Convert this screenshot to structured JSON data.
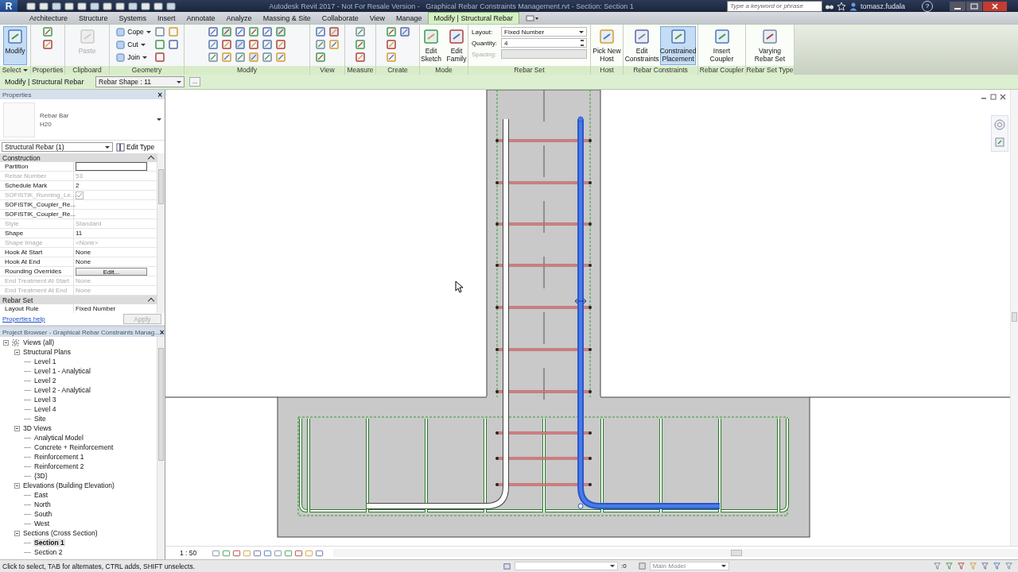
{
  "title_bar": {
    "app_button": "R",
    "title": "Autodesk Revit 2017 - Not For Resale Version -   Graphical Rebar Constraints Management.rvt - Section: Section 1",
    "search_placeholder": "Type a keyword or phrase",
    "user": "tomasz.fudala",
    "help": "?"
  },
  "tabs": [
    {
      "label": "Architecture",
      "selected": false
    },
    {
      "label": "Structure",
      "selected": false
    },
    {
      "label": "Systems",
      "selected": false
    },
    {
      "label": "Insert",
      "selected": false
    },
    {
      "label": "Annotate",
      "selected": false
    },
    {
      "label": "Analyze",
      "selected": false
    },
    {
      "label": "Massing & Site",
      "selected": false
    },
    {
      "label": "Collaborate",
      "selected": false
    },
    {
      "label": "View",
      "selected": false
    },
    {
      "label": "Manage",
      "selected": false
    },
    {
      "label": "Modify | Structural Rebar",
      "selected": true
    }
  ],
  "ribbon": {
    "panels": [
      {
        "label": "Select",
        "kind": "large",
        "dropdown": true,
        "tools": [
          {
            "lines": [
              "Modify"
            ],
            "selected": true,
            "disabled": false
          }
        ]
      },
      {
        "label": "Properties",
        "kind": "icons"
      },
      {
        "label": "Clipboard",
        "kind": "large",
        "tools": [
          {
            "lines": [
              "Paste"
            ],
            "selected": false,
            "disabled": true
          }
        ]
      },
      {
        "label": "Geometry",
        "kind": "small",
        "tools": [
          {
            "label": "Cope"
          },
          {
            "label": "Cut"
          },
          {
            "label": "Join"
          }
        ]
      },
      {
        "label": "Modify",
        "kind": "icons"
      },
      {
        "label": "View",
        "kind": "icons"
      },
      {
        "label": "Measure",
        "kind": "icons"
      },
      {
        "label": "Create",
        "kind": "icons"
      },
      {
        "label": "Mode",
        "kind": "large",
        "tools": [
          {
            "lines": [
              "Edit",
              "Sketch"
            ],
            "selected": false,
            "disabled": false
          },
          {
            "lines": [
              "Edit",
              "Family"
            ],
            "selected": false,
            "disabled": false
          }
        ]
      },
      {
        "label": "Rebar Set",
        "kind": "fields",
        "fields": [
          {
            "label": "Layout:",
            "value": "Fixed Number",
            "kind": "dropdown",
            "disabled": false
          },
          {
            "label": "Quantity:",
            "value": "4",
            "kind": "spinner",
            "disabled": false
          },
          {
            "label": "Spacing:",
            "kind": "text",
            "disabled": true
          }
        ]
      },
      {
        "label": "Host",
        "kind": "large",
        "tools": [
          {
            "lines": [
              "Pick New",
              "Host"
            ],
            "selected": false,
            "disabled": false
          }
        ]
      },
      {
        "label": "Rebar Constraints",
        "kind": "large",
        "tools": [
          {
            "lines": [
              "Edit",
              "Constraints"
            ],
            "selected": false,
            "disabled": false
          },
          {
            "lines": [
              "Constrained",
              "Placement"
            ],
            "selected": true,
            "disabled": false
          }
        ]
      },
      {
        "label": "Rebar Coupler",
        "kind": "large",
        "tools": [
          {
            "lines": [
              "Insert",
              "Coupler"
            ],
            "selected": false,
            "disabled": false
          }
        ]
      },
      {
        "label": "Rebar Set Type",
        "kind": "large",
        "tools": [
          {
            "lines": [
              "Varying",
              "Rebar Set"
            ],
            "selected": false,
            "disabled": false
          }
        ]
      }
    ]
  },
  "options_bar": {
    "context": "Modify | Structural Rebar",
    "type_selector": "Rebar Shape : 11",
    "more": "..."
  },
  "properties": {
    "title": "Properties",
    "close": "×",
    "type_family": "Rebar Bar",
    "type_name": "H20",
    "selector": "Structural Rebar (1)",
    "edit_type": "Edit Type",
    "groups": [
      {
        "name": "Construction",
        "rows": [
          {
            "name": "Partition",
            "kind": "field",
            "disabled": false
          },
          {
            "name": "Rebar Number",
            "value": "53",
            "kind": "text",
            "disabled": true
          },
          {
            "name": "Schedule Mark",
            "value": "2",
            "kind": "text",
            "disabled": false
          },
          {
            "name": "SOFiSTiK_Running_Le...",
            "kind": "checkbox",
            "checked": true,
            "disabled": true
          },
          {
            "name": "SOFiSTiK_Coupler_Re...",
            "kind": "text",
            "disabled": false
          },
          {
            "name": "SOFiSTiK_Coupler_Re...",
            "kind": "text",
            "disabled": false
          },
          {
            "name": "Style",
            "value": "Standard",
            "kind": "text",
            "disabled": true
          },
          {
            "name": "Shape",
            "value": "11",
            "kind": "text",
            "disabled": false
          },
          {
            "name": "Shape Image",
            "value": "<None>",
            "kind": "text",
            "disabled": true
          },
          {
            "name": "Hook At Start",
            "value": "None",
            "kind": "text",
            "disabled": false
          },
          {
            "name": "Hook At End",
            "value": "None",
            "kind": "text",
            "disabled": false
          },
          {
            "name": "Rounding Overrides",
            "value": "Edit...",
            "kind": "button",
            "disabled": false
          },
          {
            "name": "End Treatment At Start",
            "value": "None",
            "kind": "text",
            "disabled": true
          },
          {
            "name": "End Treatment At End",
            "value": "None",
            "kind": "text",
            "disabled": true
          }
        ]
      },
      {
        "name": "Rebar Set",
        "rows": [
          {
            "name": "Layout Rule",
            "value": "Fixed Number",
            "kind": "text",
            "disabled": false
          }
        ]
      }
    ],
    "help_link": "Properties help",
    "apply": "Apply",
    "apply_disabled": true
  },
  "browser": {
    "title": "Project Browser - Graphical Rebar Constraints Manag...",
    "close": "×",
    "tree": [
      {
        "label": "Views (all)",
        "expanded": true,
        "selected": false,
        "children": [
          {
            "label": "Structural Plans",
            "expanded": true,
            "selected": false,
            "children": [
              {
                "label": "Level 1",
                "selected": false
              },
              {
                "label": "Level 1 - Analytical",
                "selected": false
              },
              {
                "label": "Level 2",
                "selected": false
              },
              {
                "label": "Level 2 - Analytical",
                "selected": false
              },
              {
                "label": "Level 3",
                "selected": false
              },
              {
                "label": "Level 4",
                "selected": false
              },
              {
                "label": "Site",
                "selected": false
              }
            ]
          },
          {
            "label": "3D Views",
            "expanded": true,
            "selected": false,
            "children": [
              {
                "label": "Analytical Model",
                "selected": false
              },
              {
                "label": "Concrete + Reinforcement",
                "selected": false
              },
              {
                "label": "Reinforcement 1",
                "selected": false
              },
              {
                "label": "Reinforcement 2",
                "selected": false
              },
              {
                "label": "{3D}",
                "selected": false
              }
            ]
          },
          {
            "label": "Elevations (Building Elevation)",
            "expanded": true,
            "selected": false,
            "children": [
              {
                "label": "East",
                "selected": false
              },
              {
                "label": "North",
                "selected": false
              },
              {
                "label": "South",
                "selected": false
              },
              {
                "label": "West",
                "selected": false
              }
            ]
          },
          {
            "label": "Sections (Cross Section)",
            "expanded": true,
            "selected": false,
            "children": [
              {
                "label": "Section 1",
                "selected": true
              },
              {
                "label": "Section 2",
                "selected": false
              }
            ]
          }
        ]
      }
    ]
  },
  "view_bar": {
    "scale": "1 : 50"
  },
  "status_bar": {
    "message": "Click to select, TAB for alternates, CTRL adds, SHIFT unselects.",
    "selection_count": ":0",
    "model": "Main Model"
  }
}
